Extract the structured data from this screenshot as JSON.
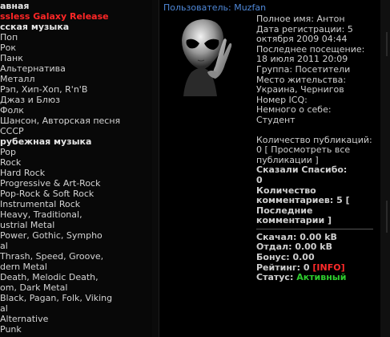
{
  "sidebar": {
    "items": [
      {
        "label": "авная",
        "style": "head"
      },
      {
        "label": "ssless Galaxy Release",
        "style": "red"
      },
      {
        "label": "сская музыка",
        "style": "head"
      },
      {
        "label": "Поп",
        "style": "item"
      },
      {
        "label": "Рок",
        "style": "item"
      },
      {
        "label": "Панк",
        "style": "item"
      },
      {
        "label": "Альтернатива",
        "style": "item"
      },
      {
        "label": "Металл",
        "style": "item"
      },
      {
        "label": "Рэп, Хип-Хоп, R'n'B",
        "style": "item"
      },
      {
        "label": "Джаз и Блюз",
        "style": "item"
      },
      {
        "label": "Фолк",
        "style": "item"
      },
      {
        "label": "Шансон, Авторская песня",
        "style": "item"
      },
      {
        "label": "СССР",
        "style": "item"
      },
      {
        "label": "рубежная музыка",
        "style": "head"
      },
      {
        "label": "Pop",
        "style": "item"
      },
      {
        "label": "Rock",
        "style": "item"
      },
      {
        "label": "Hard Rock",
        "style": "item"
      },
      {
        "label": "Progressive & Art-Rock",
        "style": "item"
      },
      {
        "label": "Pop-Rock & Soft Rock",
        "style": "item"
      },
      {
        "label": "Instrumental Rock",
        "style": "item"
      },
      {
        "label": "Heavy, Traditional,",
        "style": "item"
      },
      {
        "label": "ustrial Metal",
        "style": "item"
      },
      {
        "label": "Power, Gothic, Sympho",
        "style": "item"
      },
      {
        "label": "al",
        "style": "item"
      },
      {
        "label": "Thrash, Speed, Groove,",
        "style": "item"
      },
      {
        "label": "dern Metal",
        "style": "item"
      },
      {
        "label": "Death, Melodic Death,",
        "style": "item"
      },
      {
        "label": "om, Dark Metal",
        "style": "item"
      },
      {
        "label": "Black, Pagan, Folk, Viking",
        "style": "item"
      },
      {
        "label": "al",
        "style": "item"
      },
      {
        "label": "Alternative",
        "style": "item"
      },
      {
        "label": "Punk",
        "style": "item"
      }
    ]
  },
  "profile": {
    "user_prefix": "Пользователь: ",
    "username": "Muzfan",
    "full_name": "Полное имя: Антон",
    "registration": "Дата регистрации: 5 октября 2009 04:44",
    "last_visit": "Последнее посещение: 18 июля 2011 20:09",
    "group": "Группа: Посетители",
    "residence": "Место жительства: Украина, Чернигов",
    "icq": "Номер ICQ:",
    "about_label": "Немного о себе:",
    "about_value": "Студент",
    "publications": "Количество публикаций: 0 [",
    "publications_link": "Просмотреть все публикации",
    "publications_close": "]",
    "thanks_label": "Сказали Спасибо:",
    "thanks_value": "0",
    "comments": "Количество комментариев: 5 [",
    "comments_link": "Последние комментарии",
    "comments_close": "]",
    "downloaded": "Скачал: 0.00 kB",
    "uploaded": "Отдал: 0.00 kB",
    "bonus": "Бонус: 0.00",
    "rating_label": "Рейтинг: 0",
    "rating_info": "[INFO]",
    "status_label": "Статус:",
    "status_value": "Активный"
  },
  "colors": {
    "link": "#4f88d8",
    "warn": "#ff2a2a",
    "active": "#2ecc2e"
  },
  "icons": {
    "avatar": "alien-avatar-icon"
  }
}
